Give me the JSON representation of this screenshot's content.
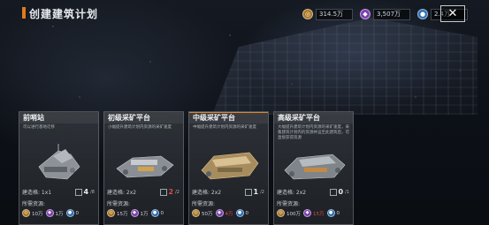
{
  "header": {
    "title": "创建建筑计划",
    "close_label": "✕",
    "resources": [
      {
        "icon": "gold-icon",
        "glyph": "◎",
        "value": "314.5万"
      },
      {
        "icon": "crystal-icon",
        "glyph": "◆",
        "value": "3,507万"
      },
      {
        "icon": "gas-icon",
        "glyph": "●",
        "value": "2.4万"
      }
    ]
  },
  "cards": [
    {
      "title": "前哨站",
      "desc": "可以进行基地迁移",
      "build_label": "建造格: 1x1",
      "count_now": "4",
      "count_max": "/8",
      "count_short": false,
      "resource_label": "所需资源:",
      "costs": [
        "10万",
        "1万",
        "0"
      ],
      "cost_short": [
        false,
        false,
        false
      ]
    },
    {
      "title": "初级采矿平台",
      "desc": "小幅提升建筑计划内资源的采矿速度",
      "build_label": "建造格: 2x2",
      "count_now": "2",
      "count_max": "/2",
      "count_short": true,
      "resource_label": "所需资源:",
      "costs": [
        "15万",
        "1万",
        "0"
      ],
      "cost_short": [
        false,
        false,
        false
      ]
    },
    {
      "title": "中级采矿平台",
      "desc": "中幅提升建筑计划内资源的采矿速度",
      "build_label": "建造格: 2x2",
      "count_now": "1",
      "count_max": "/2",
      "count_short": false,
      "resource_label": "所需资源:",
      "costs": [
        "50万",
        "4万",
        "0"
      ],
      "cost_short": [
        false,
        true,
        false
      ]
    },
    {
      "title": "高级采矿平台",
      "desc": "大幅提升建筑计划内资源的采矿速度，采集建筑计划内的资源并运至此建筑后，可直接获得资源",
      "build_label": "建造格: 2x2",
      "count_now": "0",
      "count_max": "/1",
      "count_short": false,
      "resource_label": "所需资源:",
      "costs": [
        "100万",
        "15万",
        "0"
      ],
      "cost_short": [
        false,
        true,
        false
      ]
    }
  ]
}
